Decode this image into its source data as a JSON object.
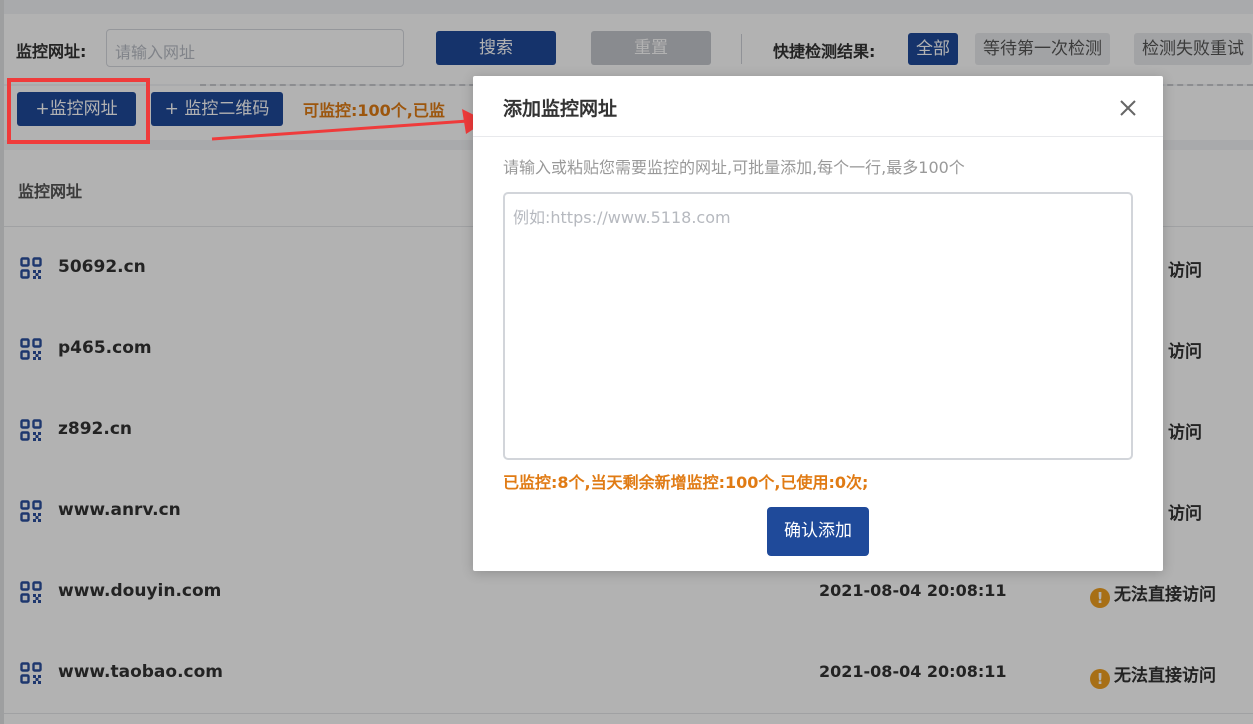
{
  "filter": {
    "url_label": "监控网址:",
    "url_placeholder": "请输入网址",
    "search_label": "搜索",
    "reset_label": "重置",
    "result_label": "快捷检测结果:",
    "chips": [
      "全部",
      "等待第一次检测",
      "检测失败重试"
    ]
  },
  "toolbar": {
    "add_url_label": "+监控网址",
    "add_qr_label": "+ 监控二维码",
    "quota_text": "可监控:100个,已监"
  },
  "table": {
    "header_url": "监控网址",
    "rows": [
      {
        "host": "50692.cn",
        "time": "",
        "status": "访问"
      },
      {
        "host": "p465.com",
        "time": "",
        "status": "访问"
      },
      {
        "host": "z892.cn",
        "time": "",
        "status": "访问"
      },
      {
        "host": "www.anrv.cn",
        "time": "",
        "status": "访问"
      },
      {
        "host": "www.douyin.com",
        "time": "2021-08-04 20:08:11",
        "status": "无法直接访问"
      },
      {
        "host": "www.taobao.com",
        "time": "2021-08-04 20:08:11",
        "status": "无法直接访问"
      }
    ]
  },
  "modal": {
    "title": "添加监控网址",
    "hint": "请输入或粘贴您需要监控的网址,可批量添加,每个一行,最多100个",
    "textarea_placeholder": "例如:https://www.5118.com",
    "stats": "已监控:8个,当天剩余新增监控:100个,已使用:0次;",
    "confirm_label": "确认添加"
  },
  "colors": {
    "primary": "#1f4a9a",
    "accent_orange": "#e07b14",
    "highlight_red": "#ef3b3b",
    "warning": "#f0a020"
  }
}
